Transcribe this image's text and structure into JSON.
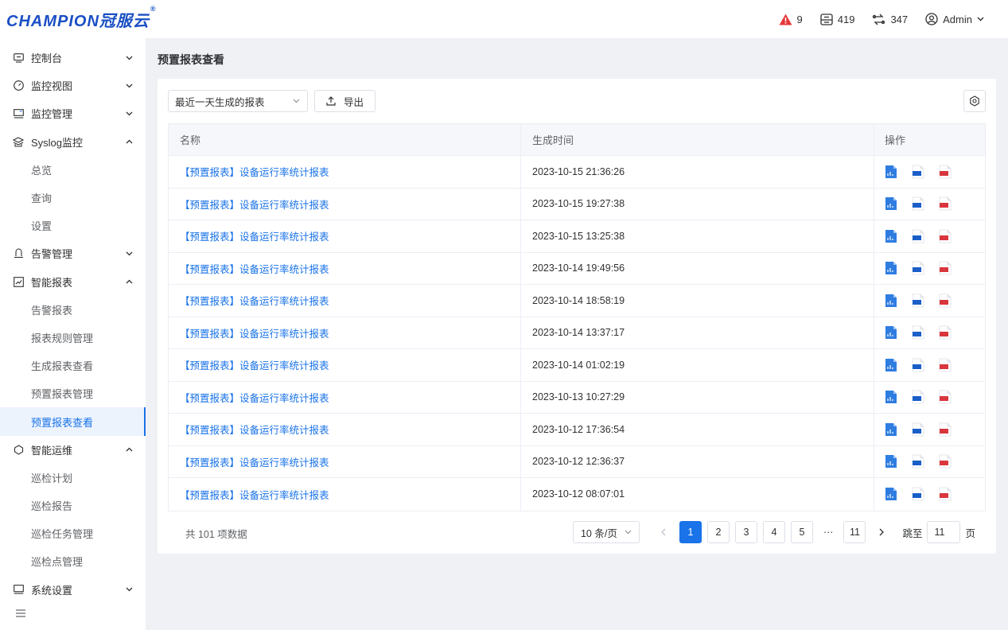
{
  "header": {
    "logo_text": "CHAMPION冠服云",
    "logo_reg": "®",
    "alerts_count": "9",
    "devices_count": "419",
    "links_count": "347",
    "user_name": "Admin"
  },
  "sidebar": {
    "items": [
      {
        "label": "控制台",
        "icon": "monitor-icon",
        "expanded": false
      },
      {
        "label": "监控视图",
        "icon": "dashboard-gauge-icon",
        "expanded": false
      },
      {
        "label": "监控管理",
        "icon": "screen-manage-icon",
        "expanded": false
      },
      {
        "label": "Syslog监控",
        "icon": "syslog-icon",
        "expanded": true,
        "children": [
          "总览",
          "查询",
          "设置"
        ]
      },
      {
        "label": "告警管理",
        "icon": "bell-icon",
        "expanded": false
      },
      {
        "label": "智能报表",
        "icon": "report-icon",
        "expanded": true,
        "children": [
          "告警报表",
          "报表规则管理",
          "生成报表查看",
          "预置报表管理",
          "预置报表查看"
        ]
      },
      {
        "label": "智能运维",
        "icon": "ops-icon",
        "expanded": true,
        "children": [
          "巡检计划",
          "巡检报告",
          "巡检任务管理",
          "巡检点管理"
        ]
      },
      {
        "label": "系统设置",
        "icon": "settings-screen-icon",
        "expanded": false
      }
    ],
    "active_child": "预置报表查看"
  },
  "main": {
    "page_title": "预置报表查看",
    "filter_value": "最近一天生成的报表",
    "export_label": "导出",
    "columns": [
      "名称",
      "生成时间",
      "操作"
    ],
    "rows": [
      {
        "name": "【预置报表】设备运行率统计报表",
        "time": "2023-10-15 21:36:26"
      },
      {
        "name": "【预置报表】设备运行率统计报表",
        "time": "2023-10-15 19:27:38"
      },
      {
        "name": "【预置报表】设备运行率统计报表",
        "time": "2023-10-15 13:25:38"
      },
      {
        "name": "【预置报表】设备运行率统计报表",
        "time": "2023-10-14 19:49:56"
      },
      {
        "name": "【预置报表】设备运行率统计报表",
        "time": "2023-10-14 18:58:19"
      },
      {
        "name": "【预置报表】设备运行率统计报表",
        "time": "2023-10-14 13:37:17"
      },
      {
        "name": "【预置报表】设备运行率统计报表",
        "time": "2023-10-14 01:02:19"
      },
      {
        "name": "【预置报表】设备运行率统计报表",
        "time": "2023-10-13 10:27:29"
      },
      {
        "name": "【预置报表】设备运行率统计报表",
        "time": "2023-10-12 17:36:54"
      },
      {
        "name": "【预置报表】设备运行率统计报表",
        "time": "2023-10-12 12:36:37"
      },
      {
        "name": "【预置报表】设备运行率统计报表",
        "time": "2023-10-12 08:07:01"
      }
    ],
    "file_icons": {
      "xls_color": "#2f7de1",
      "csv_color": "#1a5fc8",
      "pdf_color": "#d9363e"
    }
  },
  "pagination": {
    "total_text": "共 101 项数据",
    "page_size": "10 条/页",
    "pages": [
      "1",
      "2",
      "3",
      "4",
      "5",
      "···",
      "11"
    ],
    "current_page": "1",
    "jump_label": "跳至",
    "jump_value": "11",
    "page_suffix": "页"
  },
  "colors": {
    "primary": "#1a73e8",
    "logo": "#1a4fc4",
    "alert": "#e5383b"
  }
}
